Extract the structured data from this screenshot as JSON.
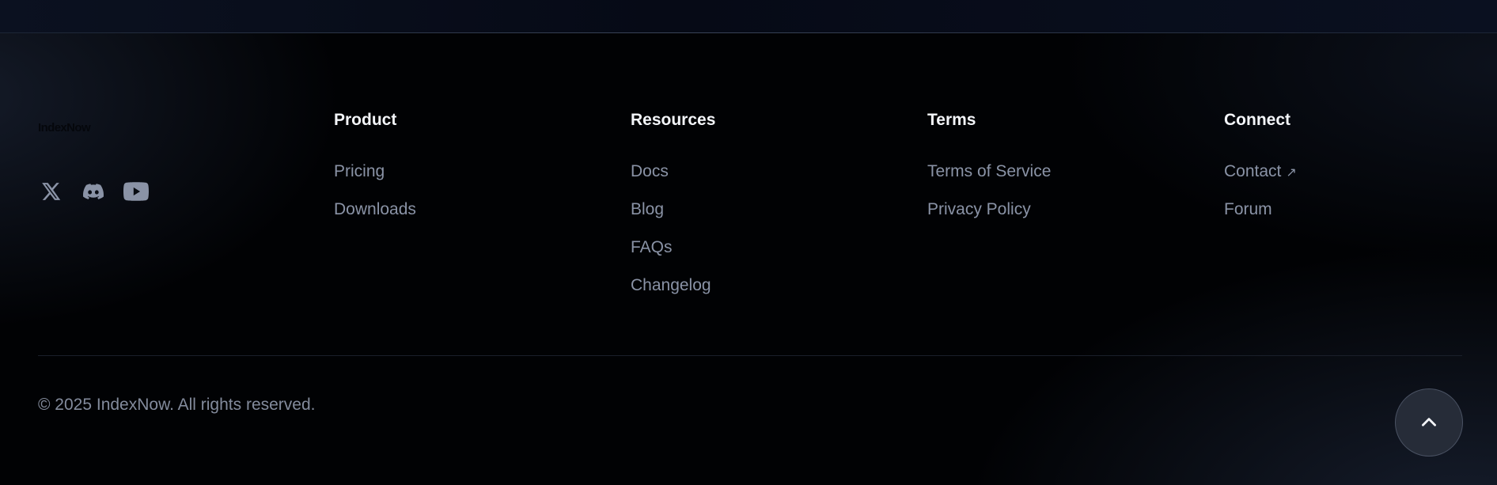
{
  "brand": {
    "logo_text": "IndexNow"
  },
  "socials": [
    {
      "name": "x-icon"
    },
    {
      "name": "discord-icon"
    },
    {
      "name": "youtube-icon"
    }
  ],
  "columns": [
    {
      "title": "Product",
      "links": [
        {
          "label": "Pricing"
        },
        {
          "label": "Downloads"
        }
      ]
    },
    {
      "title": "Resources",
      "links": [
        {
          "label": "Docs"
        },
        {
          "label": "Blog"
        },
        {
          "label": "FAQs"
        },
        {
          "label": "Changelog"
        }
      ]
    },
    {
      "title": "Terms",
      "links": [
        {
          "label": "Terms of Service"
        },
        {
          "label": "Privacy Policy"
        }
      ]
    },
    {
      "title": "Connect",
      "links": [
        {
          "label": "Contact",
          "external_icon": "↗"
        },
        {
          "label": "Forum"
        }
      ]
    }
  ],
  "copyright": "© 2025 IndexNow. All rights reserved.",
  "back_to_top": {
    "icon": "chevron-up-icon"
  },
  "colors": {
    "background": "#010204",
    "heading": "#f3f5f9",
    "link": "#8a93a6",
    "icon": "#8a93a6",
    "button_bg": "#262c38",
    "button_border": "#4a5263"
  }
}
